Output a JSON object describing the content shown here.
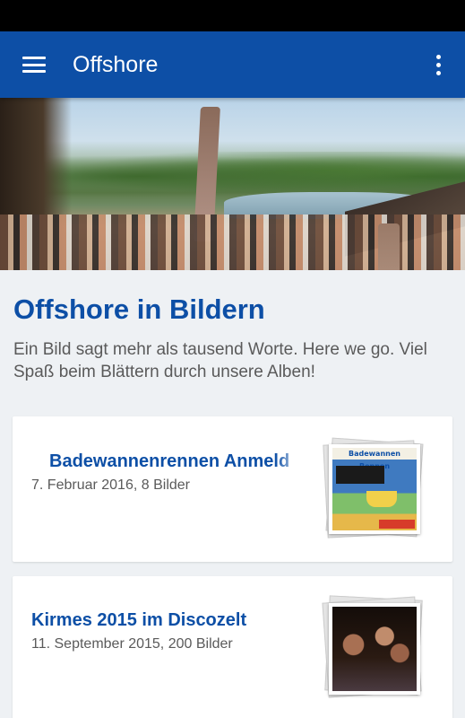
{
  "app_bar": {
    "title": "Offshore",
    "menu_icon": "hamburger-menu-icon",
    "overflow_icon": "more-vertical-icon",
    "color": "#0d4fa6"
  },
  "page": {
    "title": "Offshore in Bildern",
    "description": "Ein Bild sagt mehr als tausend Worte. Here we go. Viel Spaß beim Blättern durch unsere Alben!"
  },
  "albums": [
    {
      "title": "Badewannenrennen Anmeld",
      "meta": "7. Februar 2016, 8 Bilder",
      "thumb_banner": "Badewannen Rennen"
    },
    {
      "title": "Kirmes 2015 im Discozelt",
      "meta": "11. September 2015, 200 Bilder"
    }
  ]
}
